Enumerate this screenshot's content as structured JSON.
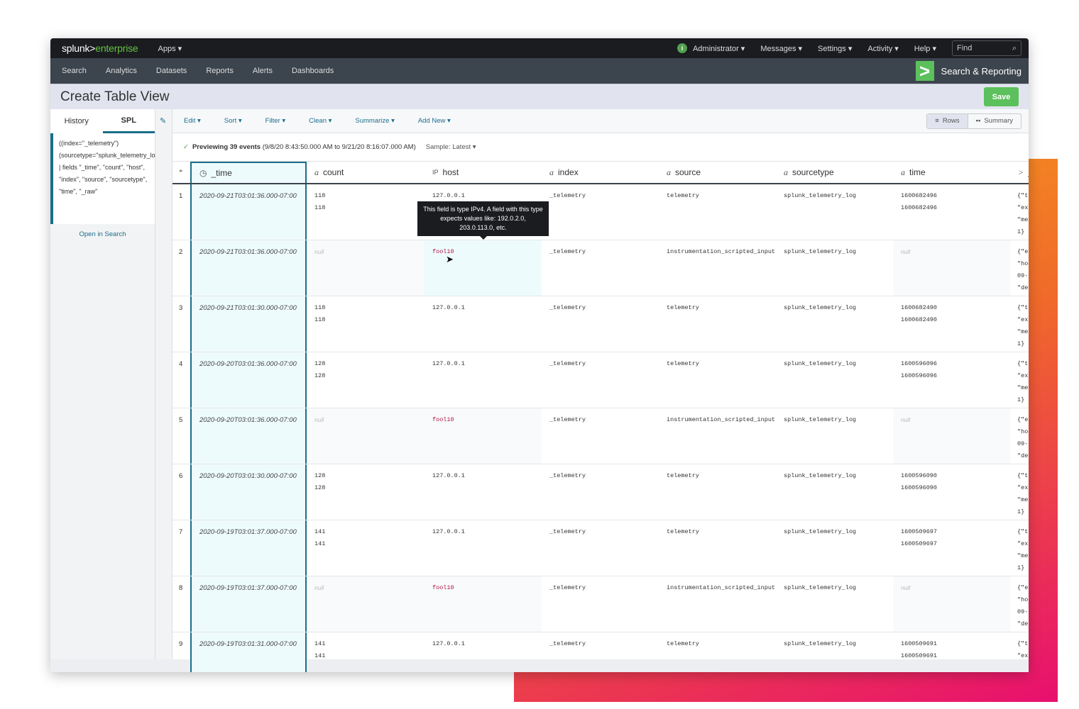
{
  "topbar": {
    "brand_a": "splunk>",
    "brand_b": "enterprise",
    "apps": "Apps ▾",
    "menus": [
      "Administrator ▾",
      "Messages ▾",
      "Settings ▾",
      "Activity ▾",
      "Help ▾"
    ],
    "find_placeholder": "Find"
  },
  "nav": {
    "items": [
      "Search",
      "Analytics",
      "Datasets",
      "Reports",
      "Alerts",
      "Dashboards"
    ],
    "app_name": "Search & Reporting"
  },
  "page": {
    "title": "Create Table View",
    "save": "Save"
  },
  "left": {
    "tabs": [
      "History",
      "SPL"
    ],
    "spl": "((index=\"_telemetry\") (sourcetype=\"splunk_telemetry_log\")) | fields \"_time\", \"count\", \"host\", \"index\", \"source\", \"sourcetype\", \"time\", \"_raw\"",
    "open_in_search": "Open in Search"
  },
  "toolbar": {
    "menus": [
      "Edit ▾",
      "Sort ▾",
      "Filter ▾",
      "Clean ▾",
      "Summarize ▾",
      "Add New ▾"
    ],
    "rows": "Rows",
    "summary": "Summary"
  },
  "preview": {
    "bold": "Previewing 39 events",
    "range": "(9/8/20 8:43:50.000 AM to 9/21/20 8:16:07.000 AM)",
    "sample": "Sample: Latest ▾"
  },
  "table": {
    "columns": [
      {
        "type": "*",
        "name": ""
      },
      {
        "type": "clock",
        "name": "_time"
      },
      {
        "type": "a",
        "name": "count"
      },
      {
        "type": "IP",
        "name": "host"
      },
      {
        "type": "a",
        "name": "index"
      },
      {
        "type": "a",
        "name": "source"
      },
      {
        "type": "a",
        "name": "sourcetype"
      },
      {
        "type": "a",
        "name": "time"
      },
      {
        "type": ">",
        "name": "_"
      }
    ],
    "rows": [
      {
        "n": "1",
        "time": "2020-09-21T03:01:36.000-07:00",
        "count": [
          "118",
          "118"
        ],
        "host": "127.0.0.1",
        "index": "_telemetry",
        "source": "telemetry",
        "sourcetype": "splunk_telemetry_log",
        "t": [
          "1600682496",
          "1600682496"
        ],
        "raw": [
          "{\"t",
          "\"ex",
          "\"me",
          "1}"
        ]
      },
      {
        "n": "2",
        "time": "2020-09-21T03:01:36.000-07:00",
        "count": null,
        "host": "fool10",
        "index": "_telemetry",
        "source": "instrumentation_scripted_input",
        "sourcetype": "splunk_telemetry_log",
        "t": null,
        "raw": [
          "{\"e",
          "\"ho",
          "09-",
          "\"de"
        ]
      },
      {
        "n": "3",
        "time": "2020-09-21T03:01:30.000-07:00",
        "count": [
          "118",
          "118"
        ],
        "host": "127.0.0.1",
        "index": "_telemetry",
        "source": "telemetry",
        "sourcetype": "splunk_telemetry_log",
        "t": [
          "1600682490",
          "1600682490"
        ],
        "raw": [
          "{\"t",
          "\"ex",
          "\"me",
          "1}"
        ]
      },
      {
        "n": "4",
        "time": "2020-09-20T03:01:36.000-07:00",
        "count": [
          "128",
          "128"
        ],
        "host": "127.0.0.1",
        "index": "_telemetry",
        "source": "telemetry",
        "sourcetype": "splunk_telemetry_log",
        "t": [
          "1600596096",
          "1600596096"
        ],
        "raw": [
          "{\"t",
          "\"ex",
          "\"me",
          "1}"
        ]
      },
      {
        "n": "5",
        "time": "2020-09-20T03:01:36.000-07:00",
        "count": null,
        "host": "fool10",
        "index": "_telemetry",
        "source": "instrumentation_scripted_input",
        "sourcetype": "splunk_telemetry_log",
        "t": null,
        "raw": [
          "{\"e",
          "\"ho",
          "09-",
          "\"de"
        ]
      },
      {
        "n": "6",
        "time": "2020-09-20T03:01:30.000-07:00",
        "count": [
          "128",
          "128"
        ],
        "host": "127.0.0.1",
        "index": "_telemetry",
        "source": "telemetry",
        "sourcetype": "splunk_telemetry_log",
        "t": [
          "1600596090",
          "1600596090"
        ],
        "raw": [
          "{\"t",
          "\"ex",
          "\"me",
          "1}"
        ]
      },
      {
        "n": "7",
        "time": "2020-09-19T03:01:37.000-07:00",
        "count": [
          "141",
          "141"
        ],
        "host": "127.0.0.1",
        "index": "_telemetry",
        "source": "telemetry",
        "sourcetype": "splunk_telemetry_log",
        "t": [
          "1600509697",
          "1600509697"
        ],
        "raw": [
          "{\"t",
          "\"ex",
          "\"me",
          "1}"
        ]
      },
      {
        "n": "8",
        "time": "2020-09-19T03:01:37.000-07:00",
        "count": null,
        "host": "fool10",
        "index": "_telemetry",
        "source": "instrumentation_scripted_input",
        "sourcetype": "splunk_telemetry_log",
        "t": null,
        "raw": [
          "{\"e",
          "\"ho",
          "09-",
          "\"de"
        ]
      },
      {
        "n": "9",
        "time": "2020-09-19T03:01:31.000-07:00",
        "count": [
          "141",
          "141"
        ],
        "host": "127.0.0.1",
        "index": "_telemetry",
        "source": "telemetry",
        "sourcetype": "splunk_telemetry_log",
        "t": [
          "1600509691",
          "1600509691"
        ],
        "raw": [
          "{\"t",
          "\"ex"
        ]
      }
    ],
    "null_label": "null"
  },
  "tooltip": "This field is type IPv4. A field with this type expects values like: 192.0.2.0, 203.0.113.0, etc.",
  "colors": {
    "accent": "#1a6e8a",
    "brand_green": "#65c341",
    "save_green": "#5cc05c",
    "invalid": "#b0143f"
  }
}
